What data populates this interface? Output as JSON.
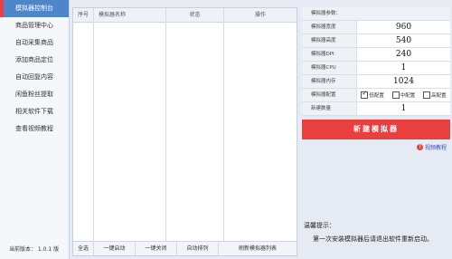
{
  "sidebar": {
    "items": [
      {
        "label": "模拟器控制台",
        "active": true
      },
      {
        "label": "商品管理中心"
      },
      {
        "label": "自动采集商品"
      },
      {
        "label": "添加商品定位"
      },
      {
        "label": "自动回复内容"
      },
      {
        "label": "闲鱼粉丝提取"
      },
      {
        "label": "相关软件下载"
      },
      {
        "label": "查看视频教程"
      }
    ],
    "version": "当前版本： 1.0.1 版"
  },
  "table": {
    "headers": [
      "序号",
      "模拟器名称",
      "状态",
      "操作"
    ],
    "footer": [
      "全选",
      "一键启动",
      "一键关闭",
      "自动排列",
      "刷新模拟器列表"
    ]
  },
  "settings": {
    "title": "模拟器参数：",
    "width_label": "模拟器宽度",
    "width": "960",
    "height_label": "模拟器高度",
    "height": "540",
    "dpi_label": "模拟器DPI",
    "dpi": "240",
    "cpu_label": "模拟器CPU",
    "cpu": "1",
    "memory_label": "模拟器内存",
    "memory": "1024",
    "config_label": "模拟器配置",
    "config_options": [
      "低配置",
      "中配置",
      "高配置"
    ],
    "config_selected": "低配置",
    "count_label": "新建数量",
    "count": "1"
  },
  "create_button": "新建模拟器",
  "tutorial_link": "视频教程",
  "tip": {
    "title": "温馨提示：",
    "text": "第一次安装模拟器后请退出软件重新启动。"
  },
  "colors": {
    "accent_red": "#e9403f",
    "sidebar_active": "#4f86c9"
  }
}
